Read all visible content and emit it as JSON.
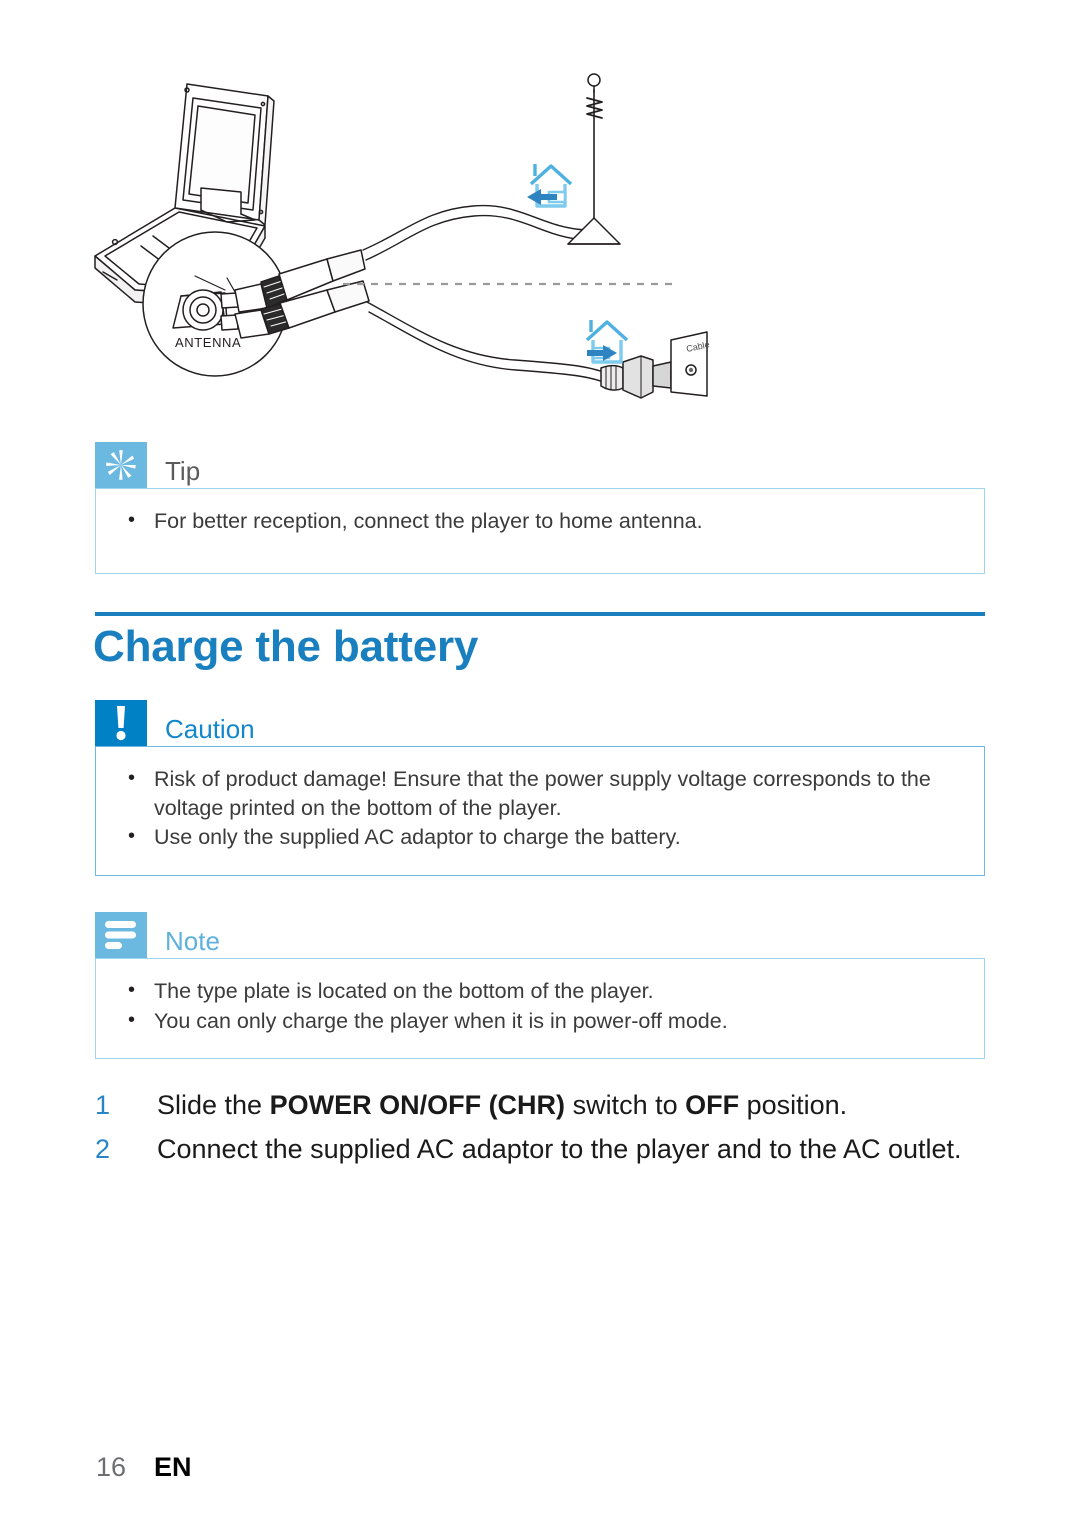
{
  "illustration": {
    "name": "connect-antenna-and-power-diagram",
    "callout_label": "ANTENNA",
    "outlet_label": "Cable",
    "house_icon_top": "house-with-left-arrow-icon",
    "house_icon_bottom": "house-with-right-arrow-icon",
    "antenna_icon": "rooftop-antenna-icon",
    "device_icon": "portable-dvd-player-icon",
    "plug_icon": "ac-plug-icon",
    "wall_outlet_icon": "wall-outlet-icon"
  },
  "tip": {
    "icon": "asterisk-icon",
    "title": "Tip",
    "items": [
      "For better reception, connect the player to home antenna."
    ]
  },
  "section": {
    "title": "Charge the battery"
  },
  "caution": {
    "icon": "exclamation-icon",
    "title": "Caution",
    "items": [
      "Risk of product damage! Ensure that the power supply voltage corresponds to the voltage printed on the bottom of the player.",
      "Use only the supplied AC adaptor to charge the battery."
    ]
  },
  "note": {
    "icon": "list-lines-icon",
    "title": "Note",
    "items": [
      "The type plate is located on the bottom of the player.",
      "You can only charge the player when it is in power-off mode."
    ]
  },
  "steps": [
    {
      "number": "1",
      "parts": [
        {
          "text": "Slide the ",
          "bold": false
        },
        {
          "text": "POWER ON/OFF (CHR)",
          "bold": true
        },
        {
          "text": " switch to ",
          "bold": false
        },
        {
          "text": "OFF",
          "bold": true
        },
        {
          "text": " position.",
          "bold": false
        }
      ]
    },
    {
      "number": "2",
      "parts": [
        {
          "text": "Connect the supplied AC adaptor to the player and to the AC outlet.",
          "bold": false
        }
      ]
    }
  ],
  "footer": {
    "page_number": "16",
    "language": "EN"
  },
  "colors": {
    "heading_blue": "#1a7fbe",
    "tip_icon_blue": "#6bb8e0",
    "caution_icon_blue": "#0081c6",
    "note_icon_blue": "#6bb8e0",
    "box_border_blue": "#9fd4ef",
    "step_number_blue": "#2a85c4",
    "house_icon_blue": "#2e9bd6"
  }
}
